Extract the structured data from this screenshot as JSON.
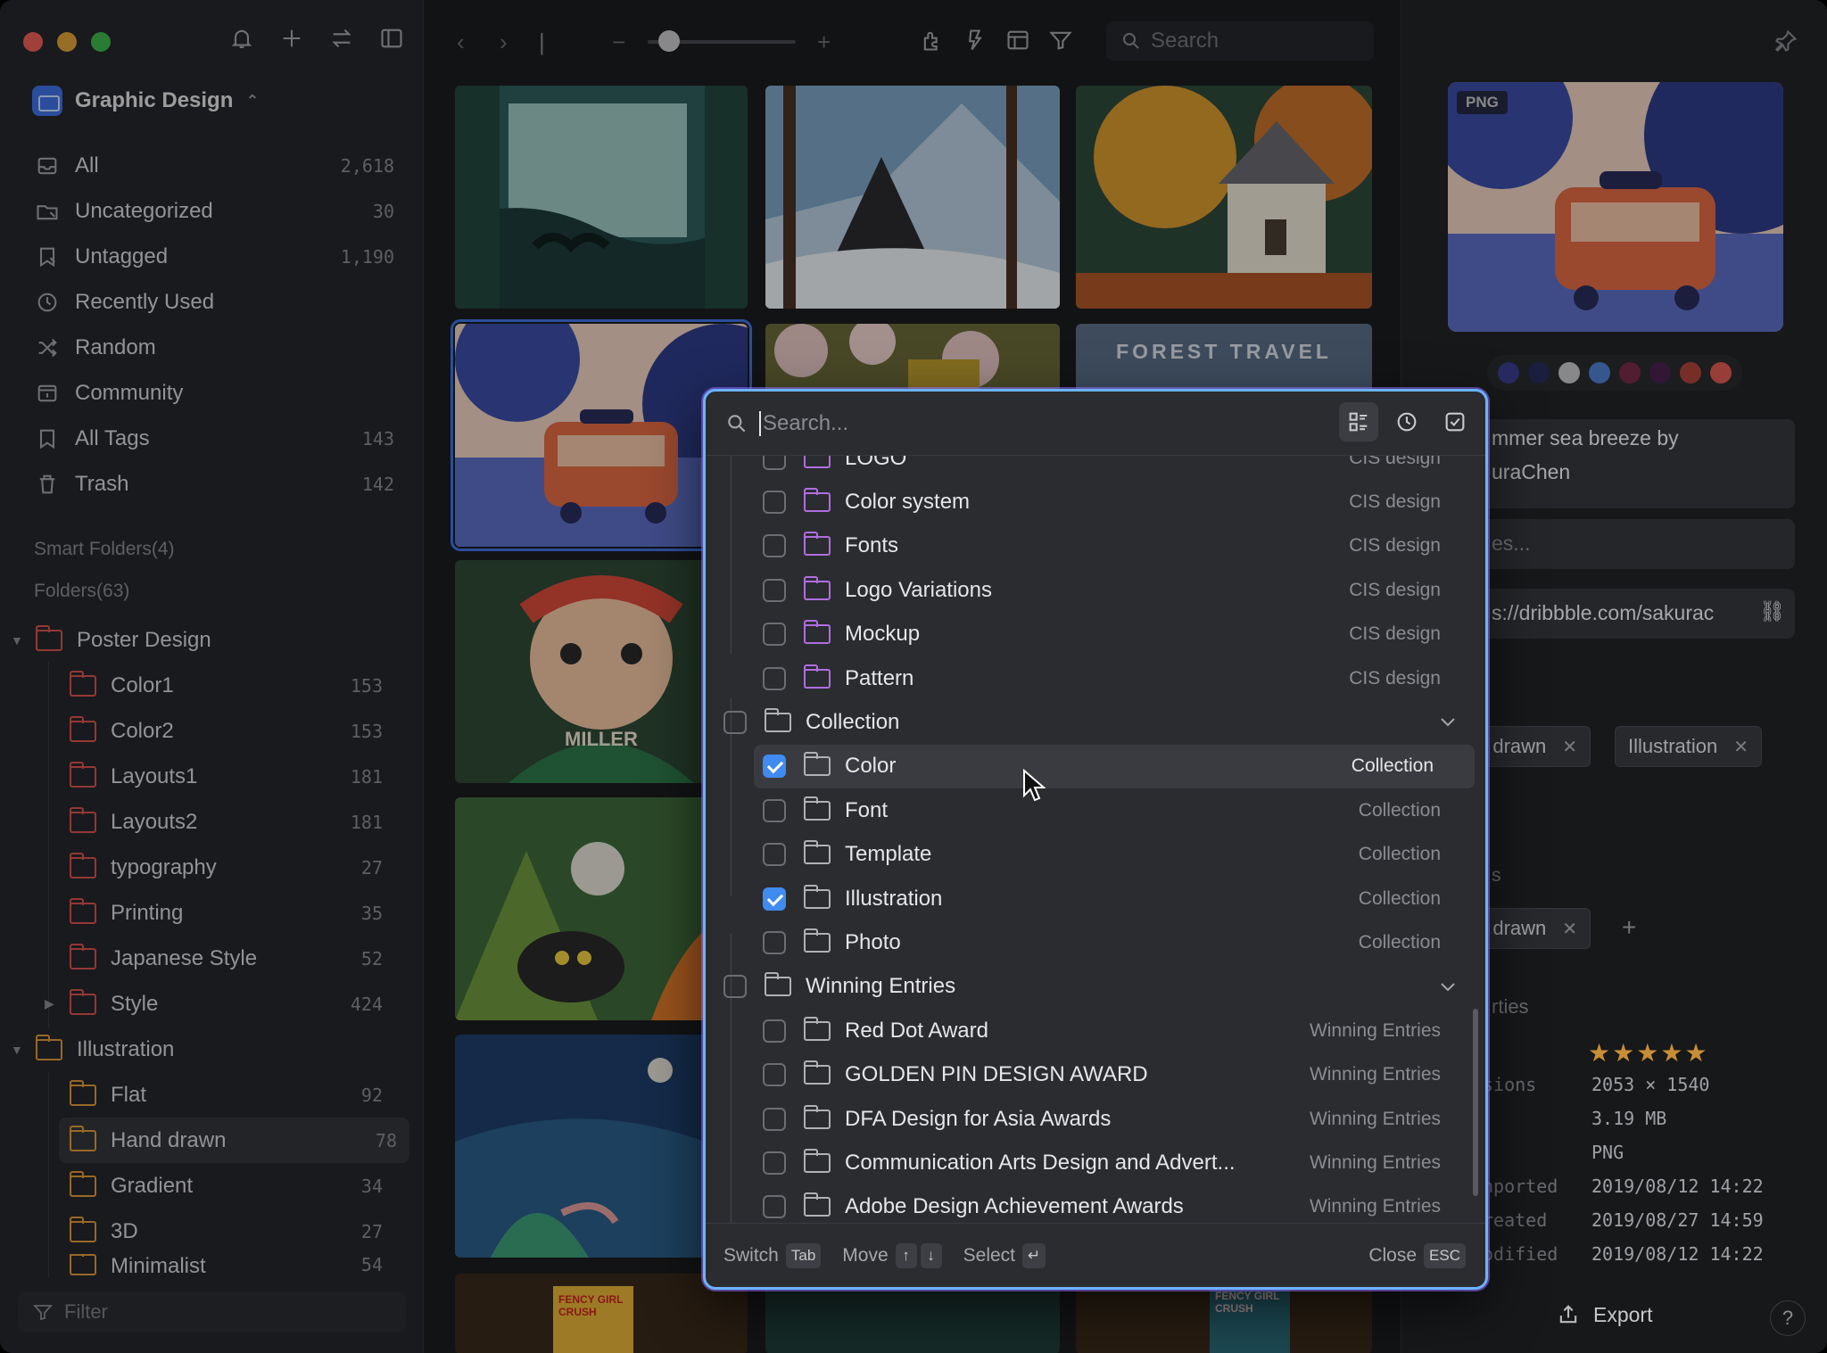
{
  "library": {
    "name": "Graphic Design"
  },
  "nav": [
    {
      "label": "All",
      "count": "2,618",
      "icon": "all-icon"
    },
    {
      "label": "Uncategorized",
      "count": "30",
      "icon": "uncategorized-icon"
    },
    {
      "label": "Untagged",
      "count": "1,190",
      "icon": "untagged-icon"
    },
    {
      "label": "Recently Used",
      "count": "",
      "icon": "clock-icon"
    },
    {
      "label": "Random",
      "count": "",
      "icon": "shuffle-icon"
    },
    {
      "label": "Community",
      "count": "",
      "icon": "community-icon"
    },
    {
      "label": "All Tags",
      "count": "143",
      "icon": "bookmark-icon"
    },
    {
      "label": "Trash",
      "count": "142",
      "icon": "trash-icon"
    }
  ],
  "sections": {
    "smart_folders": "Smart Folders(4)",
    "folders": "Folders(63)"
  },
  "tree": [
    {
      "label": "Poster Design",
      "count": "",
      "level": 0,
      "color": "red",
      "expanded": true
    },
    {
      "label": "Color1",
      "count": "153",
      "level": 1,
      "color": "red"
    },
    {
      "label": "Color2",
      "count": "153",
      "level": 1,
      "color": "red"
    },
    {
      "label": "Layouts1",
      "count": "181",
      "level": 1,
      "color": "red"
    },
    {
      "label": "Layouts2",
      "count": "181",
      "level": 1,
      "color": "red"
    },
    {
      "label": "typography",
      "count": "27",
      "level": 1,
      "color": "red"
    },
    {
      "label": "Printing",
      "count": "35",
      "level": 1,
      "color": "red"
    },
    {
      "label": "Japanese Style",
      "count": "52",
      "level": 1,
      "color": "red"
    },
    {
      "label": "Style",
      "count": "424",
      "level": 1,
      "color": "red",
      "collapsed": true
    },
    {
      "label": "Illustration",
      "count": "",
      "level": 0,
      "color": "orange",
      "expanded": true
    },
    {
      "label": "Flat",
      "count": "92",
      "level": 1,
      "color": "orange"
    },
    {
      "label": "Hand drawn",
      "count": "78",
      "level": 1,
      "color": "orange",
      "selected": true
    },
    {
      "label": "Gradient",
      "count": "34",
      "level": 1,
      "color": "orange"
    },
    {
      "label": "3D",
      "count": "27",
      "level": 1,
      "color": "orange"
    },
    {
      "label": "Minimalist",
      "count": "54",
      "level": 1,
      "color": "orange"
    }
  ],
  "filter": {
    "placeholder": "Filter"
  },
  "toolbar": {
    "search_placeholder": "Search"
  },
  "thumbnails": {
    "forest_travel": "FOREST TRAVEL",
    "miller": "MILLER",
    "fency": "FENCY GIRL CRUSH"
  },
  "inspector": {
    "format_badge": "PNG",
    "swatches": [
      "#3b3f8f",
      "#2a2d5c",
      "#c9c9cc",
      "#4f7fd1",
      "#7a2b47",
      "#4a2150",
      "#b2443c",
      "#e15a52"
    ],
    "title_line1": "mmer sea breeze by",
    "title_line2": "uraChen",
    "notes_placeholder": "es...",
    "url": "s://dribbble.com/sakurac",
    "tags": [
      "d drawn",
      "Illustration"
    ],
    "folder_header": "s",
    "folders": [
      "d drawn"
    ],
    "properties_header": "rties",
    "props": [
      {
        "label": "sions",
        "value": "2053 × 1540"
      },
      {
        "label": "",
        "value": "3.19 MB"
      },
      {
        "label": "",
        "value": "PNG"
      },
      {
        "label": "nported",
        "value": "2019/08/12 14:22"
      },
      {
        "label": "reated",
        "value": "2019/08/27 14:59"
      },
      {
        "label": "odified",
        "value": "2019/08/12 14:22"
      }
    ],
    "rating": 5,
    "export_label": "Export",
    "help": "?"
  },
  "popup": {
    "search_placeholder": "Search...",
    "rows": [
      {
        "name": "LOGO",
        "parent": "CIS design",
        "type": "child",
        "color": "purple",
        "checked": false
      },
      {
        "name": "Color system",
        "parent": "CIS design",
        "type": "child",
        "color": "purple",
        "checked": false
      },
      {
        "name": "Fonts",
        "parent": "CIS design",
        "type": "child",
        "color": "purple",
        "checked": false
      },
      {
        "name": "Logo Variations",
        "parent": "CIS design",
        "type": "child",
        "color": "purple",
        "checked": false
      },
      {
        "name": "Mockup",
        "parent": "CIS design",
        "type": "child",
        "color": "purple",
        "checked": false
      },
      {
        "name": "Pattern",
        "parent": "CIS design",
        "type": "child",
        "color": "purple",
        "checked": false
      },
      {
        "name": "Collection",
        "parent": "",
        "type": "group",
        "color": "gray",
        "checked": false
      },
      {
        "name": "Color",
        "parent": "Collection",
        "type": "child",
        "color": "gray",
        "checked": true,
        "highlight": true
      },
      {
        "name": "Font",
        "parent": "Collection",
        "type": "child",
        "color": "gray",
        "checked": false
      },
      {
        "name": "Template",
        "parent": "Collection",
        "type": "child",
        "color": "gray",
        "checked": false
      },
      {
        "name": "Illustration",
        "parent": "Collection",
        "type": "child",
        "color": "gray",
        "checked": true
      },
      {
        "name": "Photo",
        "parent": "Collection",
        "type": "child",
        "color": "gray",
        "checked": false
      },
      {
        "name": "Winning Entries",
        "parent": "",
        "type": "group",
        "color": "gray",
        "checked": false
      },
      {
        "name": "Red Dot Award",
        "parent": "Winning Entries",
        "type": "child",
        "color": "gray",
        "checked": false
      },
      {
        "name": "GOLDEN PIN DESIGN AWARD",
        "parent": "Winning Entries",
        "type": "child",
        "color": "gray",
        "checked": false
      },
      {
        "name": "DFA Design for Asia Awards",
        "parent": "Winning Entries",
        "type": "child",
        "color": "gray",
        "checked": false
      },
      {
        "name": "Communication Arts Design and Advert...",
        "parent": "Winning Entries",
        "type": "child",
        "color": "gray",
        "checked": false
      },
      {
        "name": "Adobe Design Achievement Awards",
        "parent": "Winning Entries",
        "type": "child",
        "color": "gray",
        "checked": false
      }
    ],
    "footer": {
      "switch_label": "Switch",
      "switch_key": "Tab",
      "move_label": "Move",
      "move_up": "↑",
      "move_down": "↓",
      "select_label": "Select",
      "select_key": "↵",
      "close_label": "Close",
      "close_key": "ESC"
    }
  }
}
